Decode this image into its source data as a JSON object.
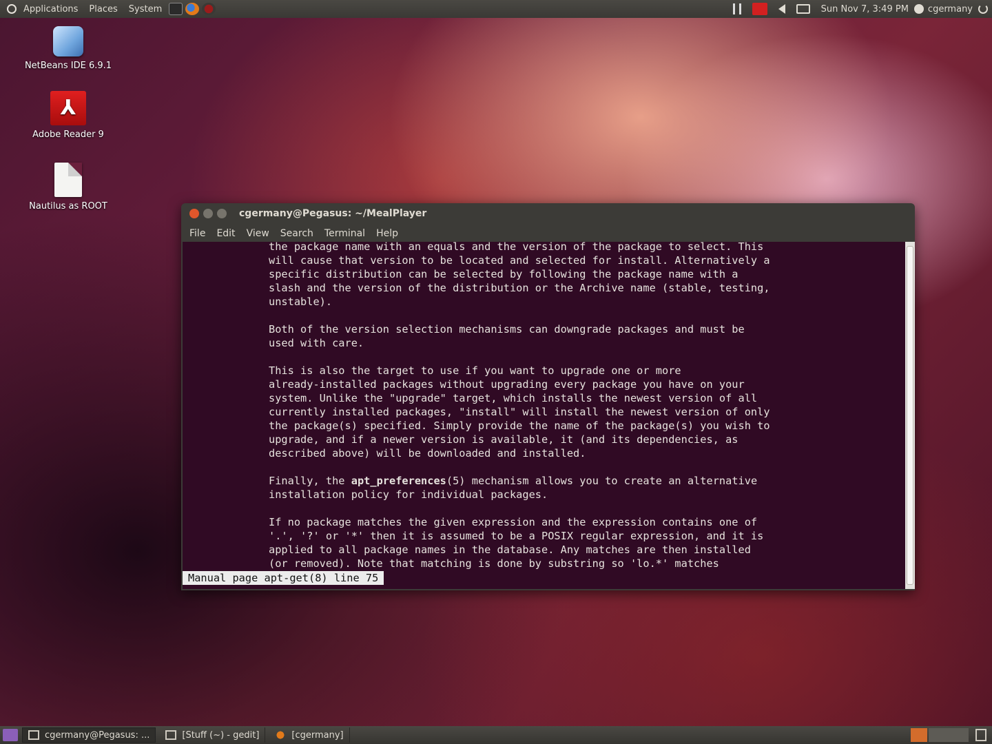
{
  "top_panel": {
    "menus": [
      "Applications",
      "Places",
      "System"
    ],
    "clock": "Sun Nov 7, 3:49 PM",
    "user": "cgermany"
  },
  "desktop_icons": [
    {
      "label": "NetBeans IDE 6.9.1",
      "icon": "netbeans-icon"
    },
    {
      "label": "Adobe Reader 9",
      "icon": "adobe-reader-icon"
    },
    {
      "label": "Nautilus as ROOT",
      "icon": "file-icon"
    }
  ],
  "terminal": {
    "title": "cgermany@Pegasus: ~/MealPlayer",
    "menu": [
      "File",
      "Edit",
      "View",
      "Search",
      "Terminal",
      "Help"
    ],
    "lines": [
      "the package name with an equals and the version of the package to select. This",
      "will cause that version to be located and selected for install. Alternatively a",
      "specific distribution can be selected by following the package name with a",
      "slash and the version of the distribution or the Archive name (stable, testing,",
      "unstable).",
      "",
      "Both of the version selection mechanisms can downgrade packages and must be",
      "used with care.",
      "",
      "This is also the target to use if you want to upgrade one or more",
      "already-installed packages without upgrading every package you have on your",
      "system. Unlike the \"upgrade\" target, which installs the newest version of all",
      "currently installed packages, \"install\" will install the newest version of only",
      "the package(s) specified. Simply provide the name of the package(s) you wish to",
      "upgrade, and if a newer version is available, it (and its dependencies, as",
      "described above) will be downloaded and installed.",
      "",
      "Finally, the apt_preferences(5) mechanism allows you to create an alternative",
      "installation policy for individual packages.",
      "",
      "If no package matches the given expression and the expression contains one of",
      "'.', '?' or '*' then it is assumed to be a POSIX regular expression, and it is",
      "applied to all package names in the database. Any matches are then installed",
      "(or removed). Note that matching is done by substring so 'lo.*' matches"
    ],
    "status": "Manual page apt-get(8) line 75"
  },
  "bottom_panel": {
    "tasks": [
      {
        "label": "cgermany@Pegasus: ...",
        "active": true
      },
      {
        "label": "[Stuff (~) - gedit]",
        "active": false
      },
      {
        "label": "[cgermany]",
        "active": false
      }
    ]
  },
  "colors": {
    "terminal_bg": "#300a24",
    "panel_bg": "#3c3b37",
    "accent": "#e0562b"
  }
}
